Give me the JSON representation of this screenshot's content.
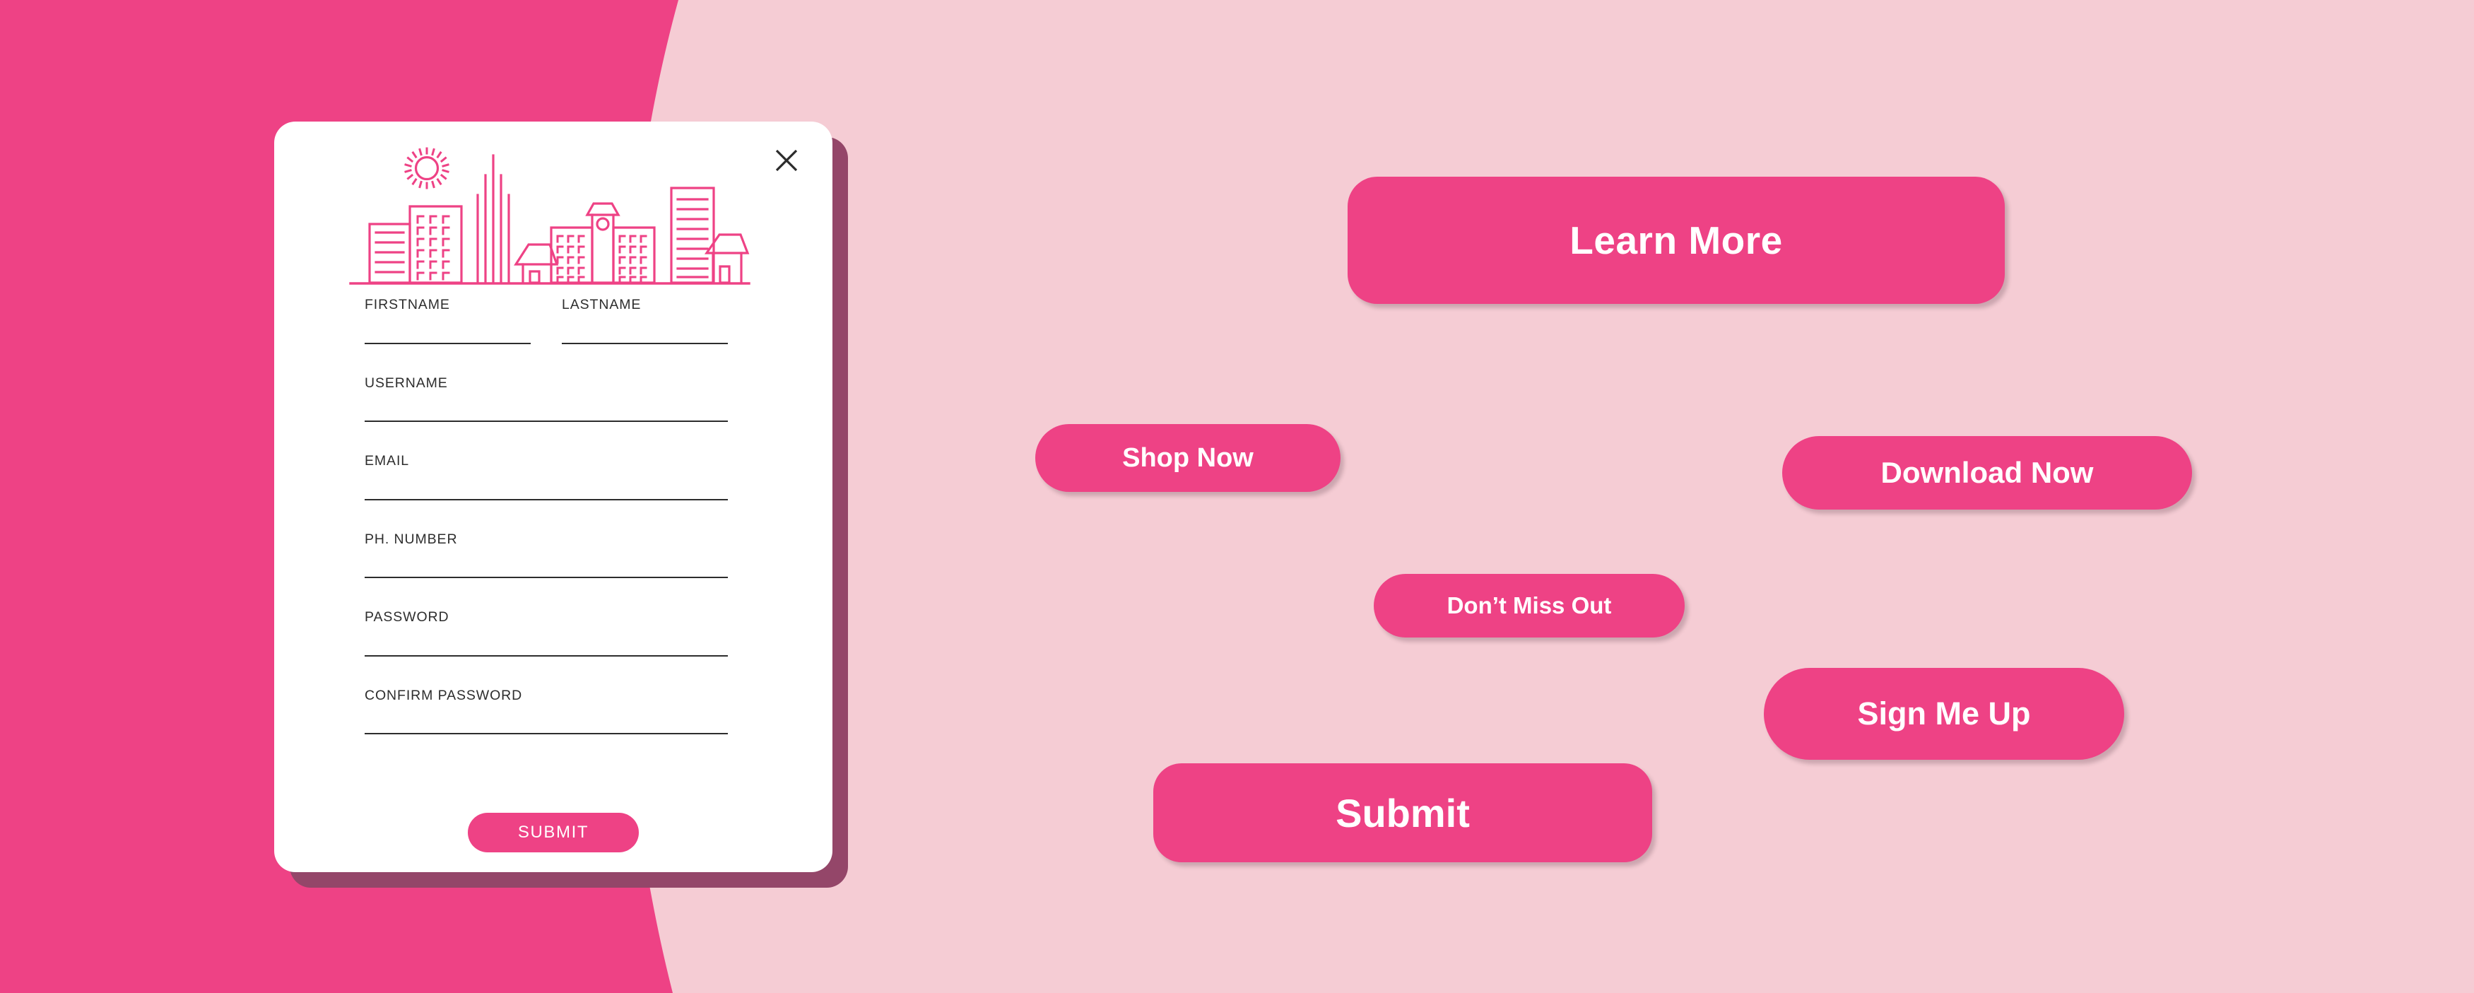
{
  "theme": {
    "accent_pink": "#ee4285",
    "background_light_pink": "#f5ccd4",
    "card_shadow_maroon": "#944669",
    "card_background": "#ffffff",
    "text_dark": "#2d2d2d",
    "button_text": "#ffffff"
  },
  "card": {
    "close_icon": "close-icon",
    "illustration": "city-skyline-illustration",
    "fields": [
      {
        "label": "FIRSTNAME",
        "value": "",
        "placeholder": ""
      },
      {
        "label": "LASTNAME",
        "value": "",
        "placeholder": ""
      },
      {
        "label": "USERNAME",
        "value": "",
        "placeholder": ""
      },
      {
        "label": "EMAIL",
        "value": "",
        "placeholder": ""
      },
      {
        "label": "PH. NUMBER",
        "value": "",
        "placeholder": ""
      },
      {
        "label": "PASSWORD",
        "value": "",
        "placeholder": ""
      },
      {
        "label": "CONFIRM PASSWORD",
        "value": "",
        "placeholder": ""
      }
    ],
    "submit_label": "SUBMIT"
  },
  "cta_buttons": [
    {
      "id": "learn-more",
      "label": "Learn More"
    },
    {
      "id": "shop-now",
      "label": "Shop Now"
    },
    {
      "id": "download-now",
      "label": "Download Now"
    },
    {
      "id": "dont-miss-out",
      "label": "Don’t Miss Out"
    },
    {
      "id": "sign-me-up",
      "label": "Sign Me Up"
    },
    {
      "id": "submit-big",
      "label": "Submit"
    }
  ]
}
